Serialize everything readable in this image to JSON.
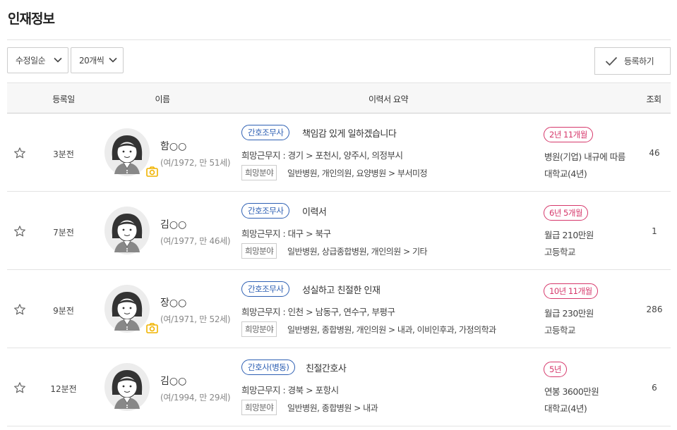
{
  "page": {
    "title": "인재정보"
  },
  "controls": {
    "sort_value": "수정일순",
    "count_value": "20개씩",
    "register_label": "등록하기"
  },
  "table": {
    "headers": {
      "date": "등록일",
      "name": "이름",
      "summary": "이력서 요약",
      "views": "조회"
    }
  },
  "rows": [
    {
      "date": "3분전",
      "name": "함○○",
      "info": "(여/1972, 만 51세)",
      "has_photo_icon": true,
      "job": "간호조무사",
      "headline": "책임감 있게 일하겠습니다",
      "region": "희망근무지 : 경기 > 포천시, 양주시, 의정부시",
      "field_tag": "희망분야",
      "fields": "일반병원, 개인의원, 요양병원 > 부서미정",
      "experience": "2년 11개월",
      "salary": "병원(기업) 내규에 따름",
      "education": "대학교(4년)",
      "views": "46"
    },
    {
      "date": "7분전",
      "name": "김○○",
      "info": "(여/1977, 만 46세)",
      "has_photo_icon": false,
      "job": "간호조무사",
      "headline": "이력서",
      "region": "희망근무지 : 대구 > 북구",
      "field_tag": "희망분야",
      "fields": "일반병원, 상급종합병원, 개인의원 > 기타",
      "experience": "6년 5개월",
      "salary": "월급 210만원",
      "education": "고등학교",
      "views": "1"
    },
    {
      "date": "9분전",
      "name": "장○○",
      "info": "(여/1971, 만 52세)",
      "has_photo_icon": true,
      "job": "간호조무사",
      "headline": "성실하고 친절한 인재",
      "region": "희망근무지 : 인천 > 남동구, 연수구, 부평구",
      "field_tag": "희망분야",
      "fields": "일반병원, 종합병원, 개인의원 > 내과, 이비인후과, 가정의학과",
      "experience": "10년 11개월",
      "salary": "월급 230만원",
      "education": "고등학교",
      "views": "286"
    },
    {
      "date": "12분전",
      "name": "김○○",
      "info": "(여/1994, 만 29세)",
      "has_photo_icon": false,
      "job": "간호사(병동)",
      "headline": "친절간호사",
      "region": "희망근무지 : 경북 > 포항시",
      "field_tag": "희망분야",
      "fields": "일반병원, 종합병원 > 내과",
      "experience": "5년",
      "salary": "연봉 3600만원",
      "education": "대학교(4년)",
      "views": "6"
    }
  ],
  "colors": {
    "job_badge": "#2d5fb3",
    "exp_badge": "#d6386b",
    "camera_icon": "#f0b400"
  },
  "icons": {
    "star": "star-icon",
    "camera": "camera-icon",
    "avatar": "avatar-placeholder-icon",
    "chevron": "chevron-down-icon",
    "check": "check-icon"
  }
}
